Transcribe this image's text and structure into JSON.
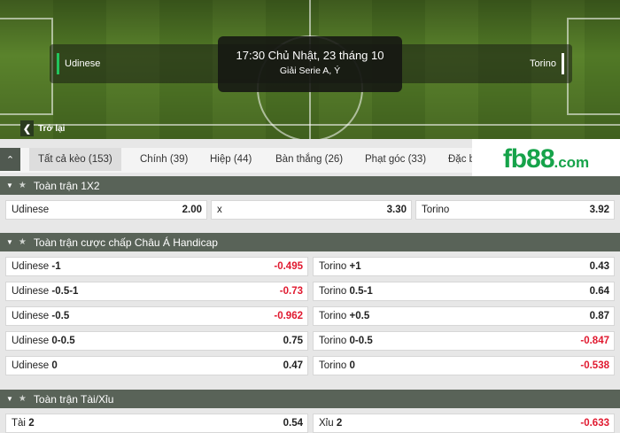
{
  "match": {
    "home": "Udinese",
    "away": "Torino",
    "time": "17:30 Chủ Nhật, 23 tháng 10",
    "league": "Giải Serie A, Ý"
  },
  "back_label": "Trở lại",
  "tabs": [
    {
      "label": "Tất cả kèo (153)"
    },
    {
      "label": "Chính (39)"
    },
    {
      "label": "Hiệp (44)"
    },
    {
      "label": "Bàn thắng (26)"
    },
    {
      "label": "Phạt góc (33)"
    },
    {
      "label": "Đặc b"
    }
  ],
  "logo": {
    "main": "fb88",
    "sub": ".com"
  },
  "sections": {
    "s1x2": {
      "title": "Toàn trận 1X2",
      "cells": [
        {
          "label": "Udinese",
          "odd": "2.00"
        },
        {
          "label": "x",
          "odd": "3.30"
        },
        {
          "label": "Torino",
          "odd": "3.92"
        }
      ]
    },
    "handicap": {
      "title": "Toàn trận cược chấp Châu Á Handicap",
      "rows": [
        {
          "lt": "Udinese",
          "lh": "-1",
          "lo": "-0.495",
          "rt": "Torino",
          "rh": "+1",
          "ro": "0.43"
        },
        {
          "lt": "Udinese",
          "lh": "-0.5-1",
          "lo": "-0.73",
          "rt": "Torino",
          "rh": "0.5-1",
          "ro": "0.64"
        },
        {
          "lt": "Udinese",
          "lh": "-0.5",
          "lo": "-0.962",
          "rt": "Torino",
          "rh": "+0.5",
          "ro": "0.87"
        },
        {
          "lt": "Udinese",
          "lh": "0-0.5",
          "lo": "0.75",
          "rt": "Torino",
          "rh": "0-0.5",
          "ro": "-0.847"
        },
        {
          "lt": "Udinese",
          "lh": "0",
          "lo": "0.47",
          "rt": "Torino",
          "rh": "0",
          "ro": "-0.538"
        }
      ]
    },
    "overunder": {
      "title": "Toàn trận Tài/Xỉu",
      "rows": [
        {
          "lt": "Tài",
          "lh": "2",
          "lo": "0.54",
          "rt": "Xỉu",
          "rh": "2",
          "ro": "-0.633"
        }
      ]
    }
  },
  "colors": {
    "accent": "#16a34a",
    "negative": "#e0192f",
    "header": "#596358"
  }
}
